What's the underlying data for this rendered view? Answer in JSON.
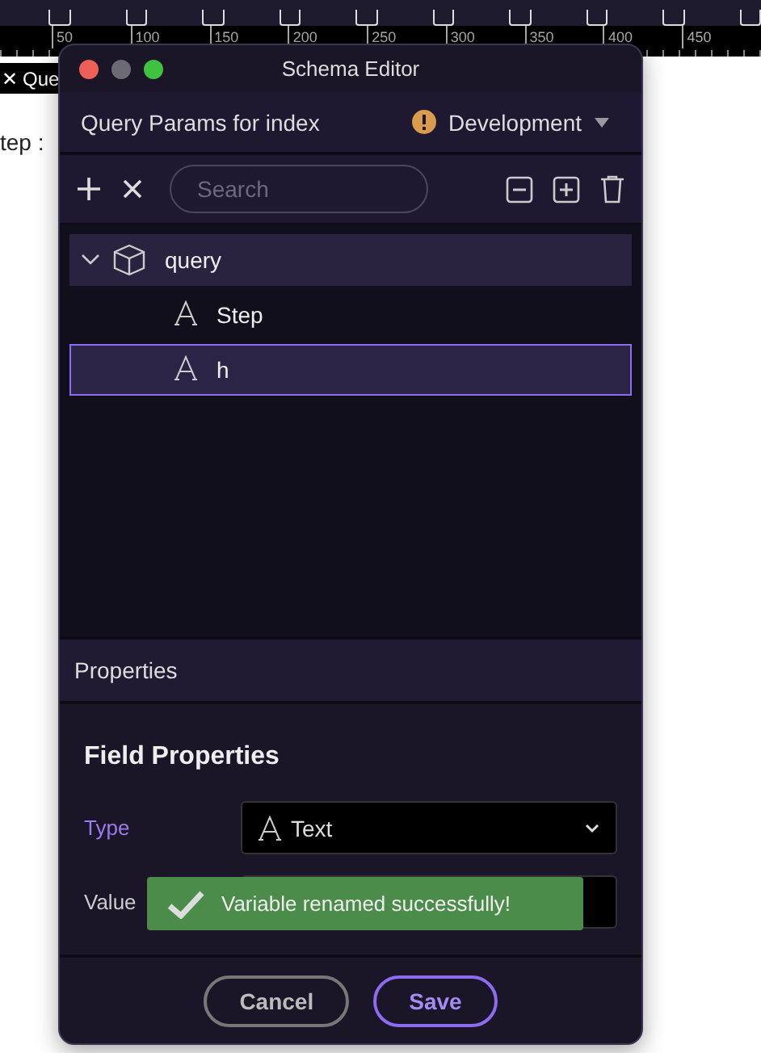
{
  "ruler": {
    "ticks": [
      "50",
      "100",
      "150",
      "200",
      "250",
      "300",
      "350",
      "400",
      "450"
    ]
  },
  "page": {
    "tab": {
      "close": "✕",
      "label": "Que"
    },
    "text": "tep :"
  },
  "window": {
    "title": "Schema Editor"
  },
  "header": {
    "title": "Query Params for index",
    "environment": "Development"
  },
  "toolbar": {
    "search": {
      "placeholder": "Search"
    }
  },
  "tree": [
    {
      "kind": "object",
      "label": "query",
      "expanded": true,
      "selected": false,
      "children": [
        {
          "kind": "text",
          "label": "Step",
          "selected": false
        },
        {
          "kind": "text",
          "label": "h",
          "selected": true
        }
      ]
    }
  ],
  "properties": {
    "title": "Properties",
    "section": "Field Properties",
    "fields": [
      {
        "label": "Type",
        "value": "Text",
        "active": true
      },
      {
        "label": "Value",
        "active": false
      }
    ]
  },
  "toast": {
    "message": "Variable renamed successfully!"
  },
  "buttons": [
    {
      "label": "Cancel",
      "primary": false
    },
    {
      "label": "Save",
      "primary": true
    }
  ]
}
